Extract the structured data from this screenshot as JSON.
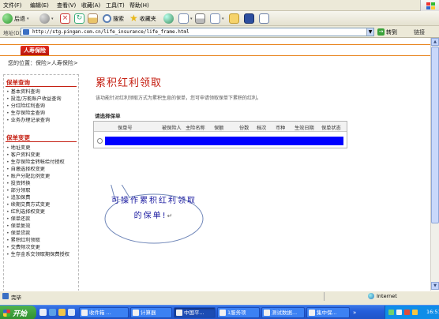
{
  "menu": {
    "items": [
      "文件(F)",
      "编辑(E)",
      "查看(V)",
      "收藏(A)",
      "工具(T)",
      "帮助(H)"
    ]
  },
  "toolbar": {
    "back_label": "后退",
    "search_label": "搜索",
    "favorites_label": "收藏夹"
  },
  "address": {
    "label": "地址(D)",
    "url": "http://stg.pingan.com.cn/life_insurance/life_frame.html",
    "go_label": "转到",
    "links_label": "链接"
  },
  "page": {
    "tab_label": "人寿保险",
    "breadcrumb": "您的位置：保险>人寿保险>",
    "sidebar": {
      "sections": [
        {
          "title": "保单查询",
          "items": [
            "基本资料查询",
            "投连/万能账户收益查询",
            "分红险红利查询",
            "生存保险金查询",
            "业务办理记录查询"
          ]
        },
        {
          "title": "保单变更",
          "items": [
            "地址变更",
            "客户资料变更",
            "生存保险金转帐给付授权",
            "自缴选择权变更",
            "账户分配比例变更",
            "投资转换",
            "部分领取",
            "追加保费",
            "续期交费方式变更",
            "红利选择权变更",
            "保单还款",
            "保单复效",
            "保单贷款",
            "累积红利领取",
            "交费频次变更",
            "生存金系交领取期保费授权"
          ]
        }
      ]
    },
    "title": "累积红利领取",
    "description": "该功能针对红利领取方式为累积生息的保单，您可申请领取保单下累积的红利。",
    "select_label": "请选择保单",
    "table": {
      "headers": [
        "保单号",
        "被保险人",
        "主险名称",
        "保额",
        "份数",
        "档次",
        "币种",
        "生效日期",
        "保单状态"
      ]
    },
    "callout_text": "可操作累积红利领取的保单!",
    "callout_mark": "↵"
  },
  "status": {
    "text": "完毕",
    "zone": "Internet"
  },
  "taskbar": {
    "start_label": "开始",
    "tasks": [
      "收件箱 ...",
      "计算器",
      "中国平...",
      "1服务项",
      "测试数据...",
      "集中保..."
    ],
    "clock": "16:51"
  },
  "colors": {
    "accent_red": "#c51f12",
    "orange_line": "#e8831b",
    "redaction": "#0000ff",
    "callout_text": "#1a1aa0"
  },
  "icons": [
    "windows-logo-icon",
    "back-icon",
    "forward-icon",
    "stop-icon",
    "refresh-icon",
    "home-icon",
    "search-icon",
    "favorites-icon",
    "history-icon",
    "mail-icon",
    "print-icon",
    "edit-icon",
    "folder-icon",
    "messenger-icon",
    "page-icon",
    "go-arrow-icon",
    "internet-globe-icon",
    "start-logo-icon"
  ]
}
